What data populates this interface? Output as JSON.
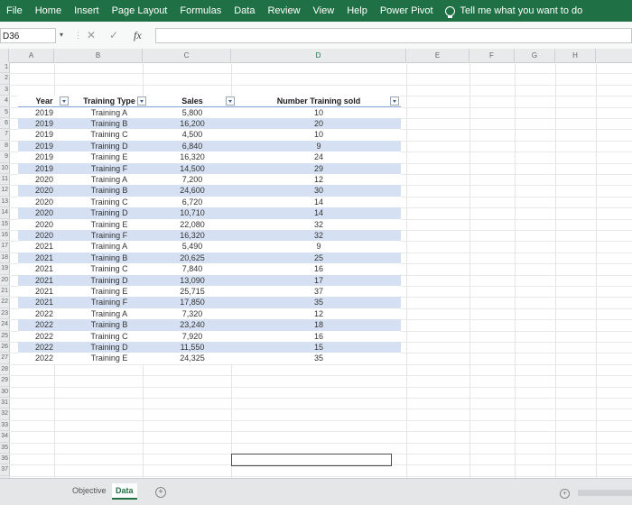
{
  "ribbon": {
    "tabs": [
      "File",
      "Home",
      "Insert",
      "Page Layout",
      "Formulas",
      "Data",
      "Review",
      "View",
      "Help",
      "Power Pivot"
    ],
    "tell_me": "Tell me what you want to do"
  },
  "formula_bar": {
    "name_box": "D36",
    "cancel_icon": "✕",
    "enter_icon": "✓",
    "fx_label": "fx",
    "value": ""
  },
  "columns": [
    "A",
    "B",
    "C",
    "D",
    "E",
    "F",
    "G",
    "H"
  ],
  "table": {
    "headers": [
      "Year",
      "Training Type",
      "Sales",
      "Number Training sold"
    ],
    "rows": [
      [
        "2019",
        "Training A",
        "5,800",
        "10"
      ],
      [
        "2019",
        "Training B",
        "16,200",
        "20"
      ],
      [
        "2019",
        "Training C",
        "4,500",
        "10"
      ],
      [
        "2019",
        "Training D",
        "6,840",
        "9"
      ],
      [
        "2019",
        "Training E",
        "16,320",
        "24"
      ],
      [
        "2019",
        "Training F",
        "14,500",
        "29"
      ],
      [
        "2020",
        "Training A",
        "7,200",
        "12"
      ],
      [
        "2020",
        "Training B",
        "24,600",
        "30"
      ],
      [
        "2020",
        "Training C",
        "6,720",
        "14"
      ],
      [
        "2020",
        "Training D",
        "10,710",
        "14"
      ],
      [
        "2020",
        "Training E",
        "22,080",
        "32"
      ],
      [
        "2020",
        "Training F",
        "16,320",
        "32"
      ],
      [
        "2021",
        "Training A",
        "5,490",
        "9"
      ],
      [
        "2021",
        "Training B",
        "20,625",
        "25"
      ],
      [
        "2021",
        "Training C",
        "7,840",
        "16"
      ],
      [
        "2021",
        "Training D",
        "13,090",
        "17"
      ],
      [
        "2021",
        "Training E",
        "25,715",
        "37"
      ],
      [
        "2021",
        "Training F",
        "17,850",
        "35"
      ],
      [
        "2022",
        "Training A",
        "7,320",
        "12"
      ],
      [
        "2022",
        "Training B",
        "23,240",
        "18"
      ],
      [
        "2022",
        "Training C",
        "7,920",
        "16"
      ],
      [
        "2022",
        "Training D",
        "11,550",
        "15"
      ],
      [
        "2022",
        "Training E",
        "24,325",
        "35"
      ]
    ]
  },
  "sheet_tabs": [
    {
      "label": "Objective",
      "active": false
    },
    {
      "label": "Data",
      "active": true
    }
  ],
  "add_sheet_icon": "+",
  "scroll_icon": "+",
  "colors": {
    "ribbon": "#1f7145",
    "band": "#d5e0f2"
  }
}
